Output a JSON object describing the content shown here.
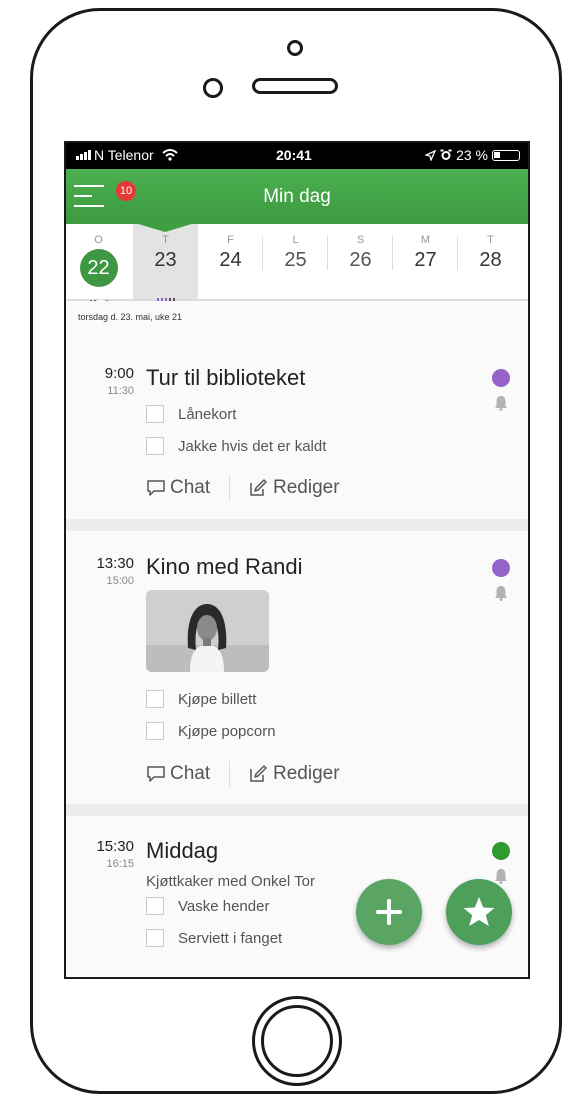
{
  "statusbar": {
    "carrier": "N Telenor",
    "time": "20:41",
    "battery": "23 %"
  },
  "header": {
    "title": "Min dag",
    "badge": "10"
  },
  "week": [
    {
      "weekday": "O",
      "date": "22"
    },
    {
      "weekday": "T",
      "date": "23"
    },
    {
      "weekday": "F",
      "date": "24"
    },
    {
      "weekday": "L",
      "date": "25"
    },
    {
      "weekday": "S",
      "date": "26"
    },
    {
      "weekday": "M",
      "date": "27"
    },
    {
      "weekday": "T",
      "date": "28"
    }
  ],
  "date_line": "torsdag d. 23. mai, uke 21",
  "events": [
    {
      "start": "9:00",
      "end": "11:30",
      "title": "Tur til biblioteket",
      "color": "#9462c8",
      "checklist": [
        "Lånekort",
        "Jakke hvis det er kaldt"
      ],
      "chat_label": "Chat",
      "edit_label": "Rediger"
    },
    {
      "start": "13:30",
      "end": "15:00",
      "title": "Kino med Randi",
      "color": "#9462c8",
      "checklist": [
        "Kjøpe billett",
        "Kjøpe popcorn"
      ],
      "chat_label": "Chat",
      "edit_label": "Rediger"
    },
    {
      "start": "15:30",
      "end": "16:15",
      "title": "Middag",
      "color": "#2e9b2e",
      "subtitle": "Kjøttkaker med Onkel Tor",
      "checklist": [
        "Vaske hender",
        "Serviett i fanget"
      ]
    }
  ],
  "colors": {
    "header_green": "#4caf50",
    "selected_day_green": "#3e9743",
    "fab_green": "#5aa564"
  }
}
